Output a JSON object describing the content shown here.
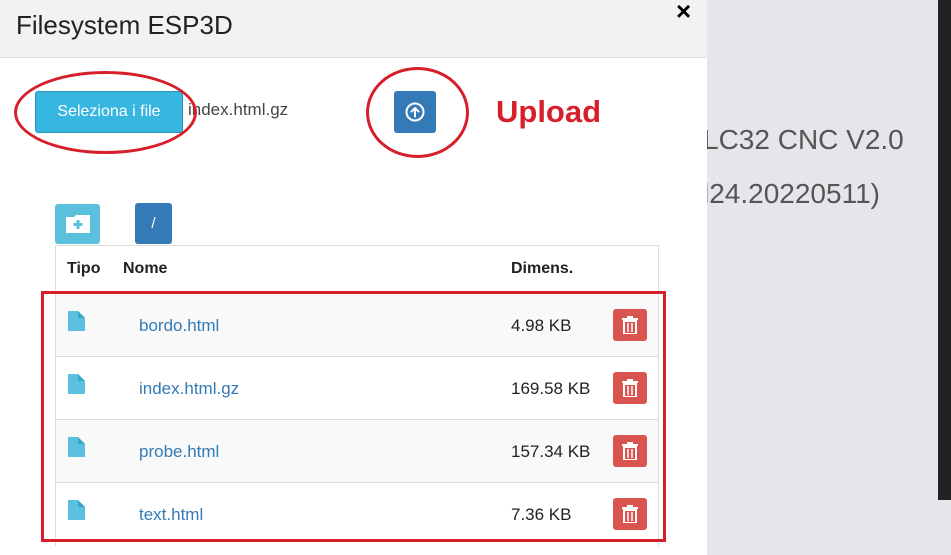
{
  "modal": {
    "title": "Filesystem ESP3D",
    "close_icon": "×"
  },
  "upload": {
    "select_files_label": "Seleziona i file",
    "selected_file_name": "index.html.gz",
    "upload_button_icon": "upload-circle-arrow-icon",
    "annotation": "Upload"
  },
  "toolbar": {
    "new_folder_icon": "folder-plus-icon",
    "root_path_label": "/"
  },
  "table": {
    "headers": {
      "type": "Tipo",
      "name": "Nome",
      "size": "Dimens."
    },
    "rows": [
      {
        "name": "bordo.html",
        "size": "4.98 KB"
      },
      {
        "name": "index.html.gz",
        "size": "169.58 KB"
      },
      {
        "name": "probe.html",
        "size": "157.34 KB"
      },
      {
        "name": "text.html",
        "size": "7.36 KB"
      }
    ]
  },
  "background": {
    "line1": "LC32 CNC V2.0",
    "line2": "l24.20220511)"
  },
  "colors": {
    "select_button": "#37b6e0",
    "primary_button": "#337ab7",
    "delete_button": "#d9534f",
    "annotation_red": "#d61f2a",
    "link": "#337ab7"
  }
}
